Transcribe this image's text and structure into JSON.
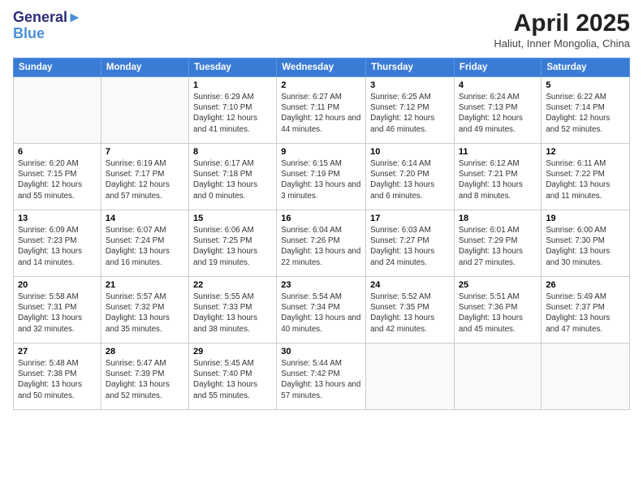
{
  "header": {
    "logo_line1": "General",
    "logo_line2": "Blue",
    "month": "April 2025",
    "location": "Haliut, Inner Mongolia, China"
  },
  "weekdays": [
    "Sunday",
    "Monday",
    "Tuesday",
    "Wednesday",
    "Thursday",
    "Friday",
    "Saturday"
  ],
  "weeks": [
    [
      {
        "day": "",
        "info": ""
      },
      {
        "day": "",
        "info": ""
      },
      {
        "day": "1",
        "info": "Sunrise: 6:29 AM\nSunset: 7:10 PM\nDaylight: 12 hours and 41 minutes."
      },
      {
        "day": "2",
        "info": "Sunrise: 6:27 AM\nSunset: 7:11 PM\nDaylight: 12 hours and 44 minutes."
      },
      {
        "day": "3",
        "info": "Sunrise: 6:25 AM\nSunset: 7:12 PM\nDaylight: 12 hours and 46 minutes."
      },
      {
        "day": "4",
        "info": "Sunrise: 6:24 AM\nSunset: 7:13 PM\nDaylight: 12 hours and 49 minutes."
      },
      {
        "day": "5",
        "info": "Sunrise: 6:22 AM\nSunset: 7:14 PM\nDaylight: 12 hours and 52 minutes."
      }
    ],
    [
      {
        "day": "6",
        "info": "Sunrise: 6:20 AM\nSunset: 7:15 PM\nDaylight: 12 hours and 55 minutes."
      },
      {
        "day": "7",
        "info": "Sunrise: 6:19 AM\nSunset: 7:17 PM\nDaylight: 12 hours and 57 minutes."
      },
      {
        "day": "8",
        "info": "Sunrise: 6:17 AM\nSunset: 7:18 PM\nDaylight: 13 hours and 0 minutes."
      },
      {
        "day": "9",
        "info": "Sunrise: 6:15 AM\nSunset: 7:19 PM\nDaylight: 13 hours and 3 minutes."
      },
      {
        "day": "10",
        "info": "Sunrise: 6:14 AM\nSunset: 7:20 PM\nDaylight: 13 hours and 6 minutes."
      },
      {
        "day": "11",
        "info": "Sunrise: 6:12 AM\nSunset: 7:21 PM\nDaylight: 13 hours and 8 minutes."
      },
      {
        "day": "12",
        "info": "Sunrise: 6:11 AM\nSunset: 7:22 PM\nDaylight: 13 hours and 11 minutes."
      }
    ],
    [
      {
        "day": "13",
        "info": "Sunrise: 6:09 AM\nSunset: 7:23 PM\nDaylight: 13 hours and 14 minutes."
      },
      {
        "day": "14",
        "info": "Sunrise: 6:07 AM\nSunset: 7:24 PM\nDaylight: 13 hours and 16 minutes."
      },
      {
        "day": "15",
        "info": "Sunrise: 6:06 AM\nSunset: 7:25 PM\nDaylight: 13 hours and 19 minutes."
      },
      {
        "day": "16",
        "info": "Sunrise: 6:04 AM\nSunset: 7:26 PM\nDaylight: 13 hours and 22 minutes."
      },
      {
        "day": "17",
        "info": "Sunrise: 6:03 AM\nSunset: 7:27 PM\nDaylight: 13 hours and 24 minutes."
      },
      {
        "day": "18",
        "info": "Sunrise: 6:01 AM\nSunset: 7:29 PM\nDaylight: 13 hours and 27 minutes."
      },
      {
        "day": "19",
        "info": "Sunrise: 6:00 AM\nSunset: 7:30 PM\nDaylight: 13 hours and 30 minutes."
      }
    ],
    [
      {
        "day": "20",
        "info": "Sunrise: 5:58 AM\nSunset: 7:31 PM\nDaylight: 13 hours and 32 minutes."
      },
      {
        "day": "21",
        "info": "Sunrise: 5:57 AM\nSunset: 7:32 PM\nDaylight: 13 hours and 35 minutes."
      },
      {
        "day": "22",
        "info": "Sunrise: 5:55 AM\nSunset: 7:33 PM\nDaylight: 13 hours and 38 minutes."
      },
      {
        "day": "23",
        "info": "Sunrise: 5:54 AM\nSunset: 7:34 PM\nDaylight: 13 hours and 40 minutes."
      },
      {
        "day": "24",
        "info": "Sunrise: 5:52 AM\nSunset: 7:35 PM\nDaylight: 13 hours and 42 minutes."
      },
      {
        "day": "25",
        "info": "Sunrise: 5:51 AM\nSunset: 7:36 PM\nDaylight: 13 hours and 45 minutes."
      },
      {
        "day": "26",
        "info": "Sunrise: 5:49 AM\nSunset: 7:37 PM\nDaylight: 13 hours and 47 minutes."
      }
    ],
    [
      {
        "day": "27",
        "info": "Sunrise: 5:48 AM\nSunset: 7:38 PM\nDaylight: 13 hours and 50 minutes."
      },
      {
        "day": "28",
        "info": "Sunrise: 5:47 AM\nSunset: 7:39 PM\nDaylight: 13 hours and 52 minutes."
      },
      {
        "day": "29",
        "info": "Sunrise: 5:45 AM\nSunset: 7:40 PM\nDaylight: 13 hours and 55 minutes."
      },
      {
        "day": "30",
        "info": "Sunrise: 5:44 AM\nSunset: 7:42 PM\nDaylight: 13 hours and 57 minutes."
      },
      {
        "day": "",
        "info": ""
      },
      {
        "day": "",
        "info": ""
      },
      {
        "day": "",
        "info": ""
      }
    ]
  ]
}
